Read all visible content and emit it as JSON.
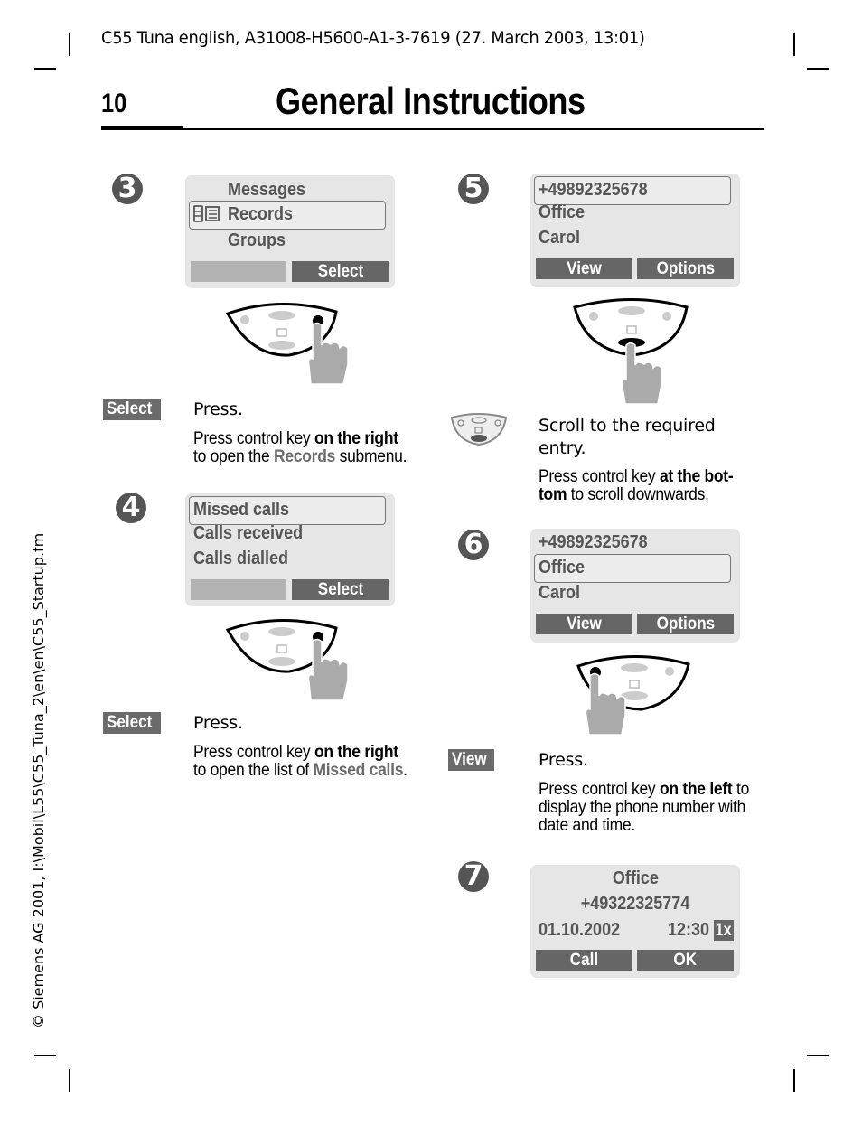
{
  "page": {
    "header_line": "C55 Tuna english, A31008-H5600-A1-3-7619 (27. March 2003, 13:01)",
    "page_number": "10",
    "title": "General Instructions",
    "side_text": "© Siemens AG 2001, I:\\Mobil\\L55\\C55_Tuna_2\\en\\en\\C55_Startup.fm"
  },
  "steps": {
    "s3": {
      "number": "3",
      "screen": {
        "rows": [
          {
            "text": "Messages",
            "selected": false
          },
          {
            "text": "Records",
            "selected": true,
            "icon": "phonebook-icon"
          },
          {
            "text": "Groups",
            "selected": false
          }
        ],
        "softkeys": [
          "",
          "Select"
        ]
      },
      "key_pressed": "right",
      "action_label": "Select",
      "press_text": "Press.",
      "desc_pre": "Press control key ",
      "desc_bold": "on the right",
      "desc_line2_pre": "to open the ",
      "desc_highlight": "Records",
      "desc_line2_post": " submenu."
    },
    "s4": {
      "number": "4",
      "screen": {
        "rows": [
          {
            "text": "Missed calls",
            "selected": true
          },
          {
            "text": "Calls received",
            "selected": false
          },
          {
            "text": "Calls dialled",
            "selected": false
          }
        ],
        "softkeys": [
          "",
          "Select"
        ]
      },
      "key_pressed": "right",
      "action_label": "Select",
      "press_text": "Press.",
      "desc_pre": "Press control key ",
      "desc_bold": "on the right",
      "desc_line2_pre": "to open the list of ",
      "desc_highlight": "Missed calls",
      "desc_line2_post": "."
    },
    "s5": {
      "number": "5",
      "screen": {
        "rows": [
          {
            "text": "+49892325678",
            "selected": true
          },
          {
            "text": "Office",
            "selected": false
          },
          {
            "text": "Carol",
            "selected": false
          }
        ],
        "softkeys": [
          "View",
          "Options"
        ]
      },
      "key_pressed": "bottom",
      "scroll_text_line1": "Scroll to the required",
      "scroll_text_line2": "entry.",
      "desc_pre": "Press control key ",
      "desc_bold": "at the bot-",
      "desc_bold2": "tom",
      "desc_line2_post": " to scroll downwards."
    },
    "s6": {
      "number": "6",
      "screen": {
        "rows": [
          {
            "text": "+49892325678",
            "selected": false
          },
          {
            "text": "Office",
            "selected": true
          },
          {
            "text": "Carol",
            "selected": false
          }
        ],
        "softkeys": [
          "View",
          "Options"
        ]
      },
      "key_pressed": "left",
      "action_label": "View",
      "press_text": "Press.",
      "desc_pre": "Press control key ",
      "desc_bold": "on the left",
      "desc_post": " to",
      "desc_line2": "display the phone number with",
      "desc_line3": "date and time."
    },
    "s7": {
      "number": "7",
      "screen": {
        "name": "Office",
        "number": "+49322325774",
        "date": "01.10.2002",
        "time": "12:30",
        "count_badge": "1x",
        "softkeys": [
          "Call",
          "OK"
        ]
      }
    }
  }
}
